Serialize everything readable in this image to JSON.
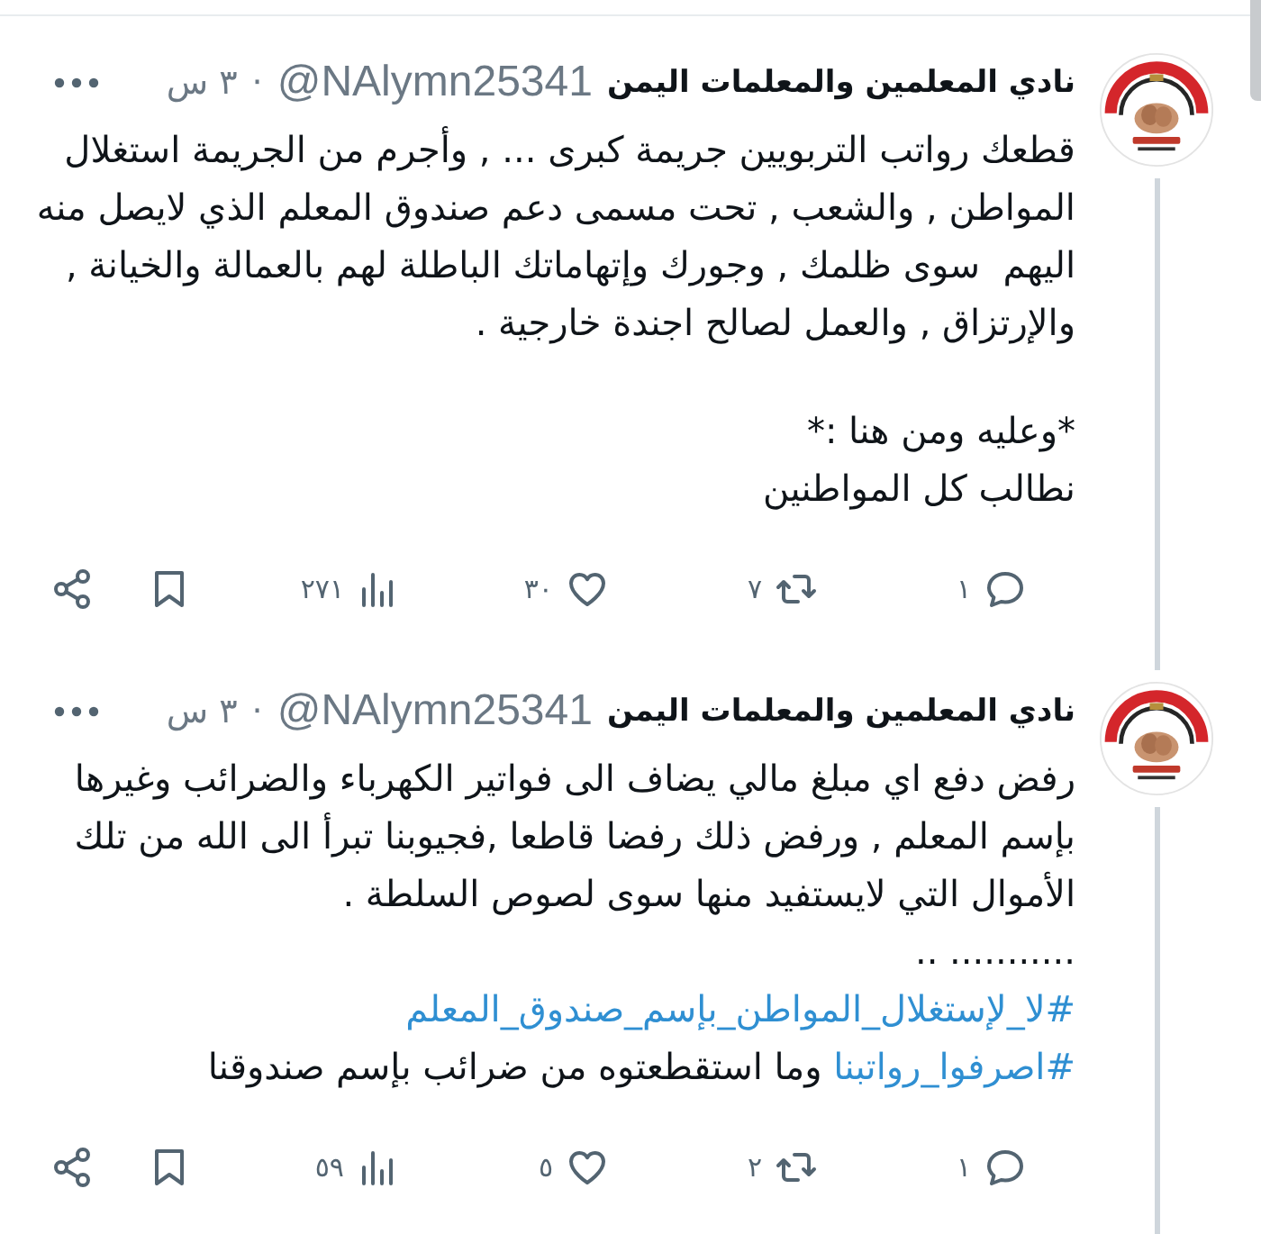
{
  "tweets": [
    {
      "author": {
        "name": "نادي المعلمين والمعلمات اليمن",
        "handle": "@NAlymn25341",
        "separator": "·",
        "time": "٣ س"
      },
      "threaded": true,
      "paragraphs": [
        [
          [
            {
              "kind": "text",
              "text": "قطعك رواتب التربويين جريمة كبرى ... , وأجرم من الجريمة استغلال"
            }
          ],
          [
            {
              "kind": "text",
              "text": "المواطن , والشعب , تحت مسمى دعم صندوق المعلم الذي لايصل منه"
            }
          ],
          [
            {
              "kind": "text",
              "text": "اليهم  سوى ظلمك , وجورك وإتهاماتك الباطلة لهم بالعمالة والخيانة ,"
            }
          ],
          [
            {
              "kind": "text",
              "text": "والإرتزاق , والعمل لصالح اجندة خارجية ."
            }
          ]
        ],
        [
          [
            {
              "kind": "text",
              "text": "*وعليه ومن هنا :*"
            }
          ],
          [
            {
              "kind": "text",
              "text": "نطالب كل المواطنين"
            }
          ]
        ]
      ],
      "actions": [
        {
          "kind": "reply",
          "count": "١"
        },
        {
          "kind": "repost",
          "count": "٧"
        },
        {
          "kind": "like",
          "count": "٣٠"
        },
        {
          "kind": "views",
          "count": "٢٧١"
        },
        {
          "kind": "bookmark"
        },
        {
          "kind": "share"
        }
      ]
    },
    {
      "author": {
        "name": "نادي المعلمين والمعلمات اليمن",
        "handle": "@NAlymn25341",
        "separator": "·",
        "time": "٣ س"
      },
      "threaded": true,
      "paragraphs": [
        [
          [
            {
              "kind": "text",
              "text": "رفض دفع اي مبلغ مالي يضاف الى فواتير الكهرباء والضرائب وغيرها"
            }
          ],
          [
            {
              "kind": "text",
              "text": "بإسم المعلم , ورفض ذلك رفضا قاطعا ,فجيوبنا تبرأ الى الله من تلك"
            }
          ],
          [
            {
              "kind": "text",
              "text": "الأموال التي لايستفيد منها سوى لصوص السلطة ."
            }
          ],
          [
            {
              "kind": "text",
              "text": "........... .."
            }
          ],
          [
            {
              "kind": "hashtag",
              "text": "#لا_لإستغلال_المواطن_بإسم_صندوق_المعلم"
            }
          ],
          [
            {
              "kind": "hashtag",
              "text": "#اصرفوا_رواتبنا"
            },
            {
              "kind": "text",
              "text": " وما استقطعتوه من ضرائب بإسم صندوقنا"
            }
          ]
        ]
      ],
      "actions": [
        {
          "kind": "reply",
          "count": "١"
        },
        {
          "kind": "repost",
          "count": "٢"
        },
        {
          "kind": "like",
          "count": "٥"
        },
        {
          "kind": "views",
          "count": "٥٩"
        },
        {
          "kind": "bookmark"
        },
        {
          "kind": "share"
        }
      ]
    }
  ]
}
